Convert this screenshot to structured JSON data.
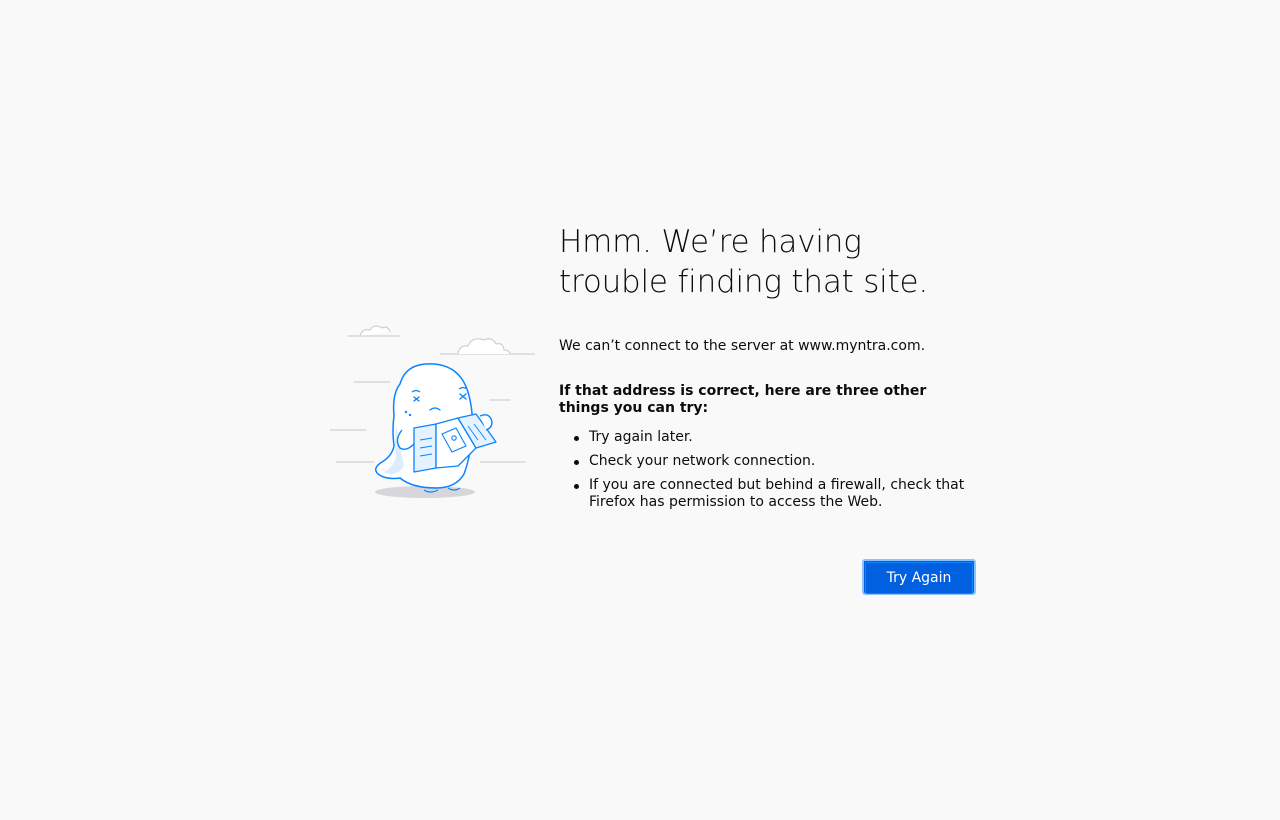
{
  "page": {
    "title": "Hmm. We’re having trouble finding that site.",
    "message": "We can’t connect to the server at www.myntra.com.",
    "suggestions_heading": "If that address is correct, here are three other things you can try:",
    "suggestions": [
      "Try again later.",
      "Check your network connection.",
      "If you are connected but behind a firewall, check that Firefox has permission to access the Web."
    ],
    "try_again_label": "Try Again"
  },
  "colors": {
    "background": "#f9f9fa",
    "text": "#0c0c0d",
    "button": "#0060df",
    "button_focus_ring": "#8cc0ff",
    "illustration_stroke": "#0a84ff",
    "illustration_fill": "#ffffff",
    "illustration_tint": "#e5f2ff"
  },
  "icons": {
    "illustration": "lost-monster-with-map-illustration"
  }
}
